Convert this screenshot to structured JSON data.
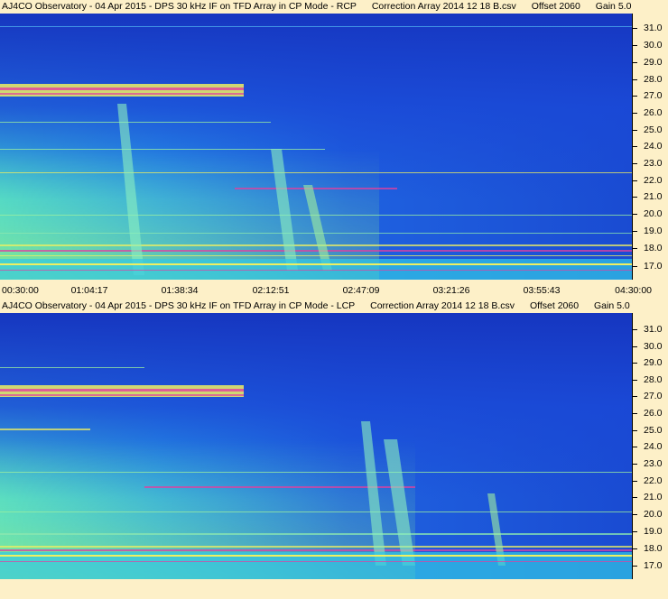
{
  "panels": [
    {
      "title_left": "AJ4CO Observatory - 04 Apr 2015 - DPS 30 kHz IF on TFD Array in CP Mode - RCP",
      "title_correction": "Correction Array 2014 12 18 B.csv",
      "title_offset": "Offset 2060",
      "title_gain": "Gain 5.0",
      "polarization": "RCP"
    },
    {
      "title_left": "AJ4CO Observatory - 04 Apr 2015 - DPS 30 kHz IF on TFD Array in CP Mode - LCP",
      "title_correction": "Correction Array 2014 12 18 B.csv",
      "title_offset": "Offset 2060",
      "title_gain": "Gain 5.0",
      "polarization": "LCP"
    }
  ],
  "y_axis_ticks": [
    "31.0",
    "30.0",
    "29.0",
    "28.0",
    "27.0",
    "26.0",
    "25.0",
    "24.0",
    "23.0",
    "22.0",
    "21.0",
    "20.0",
    "19.0",
    "18.0",
    "17.0"
  ],
  "x_axis_ticks": [
    "00:30:00",
    "01:04:17",
    "01:38:34",
    "02:12:51",
    "02:47:09",
    "03:21:26",
    "03:55:43",
    "04:30:00"
  ],
  "colors": {
    "background": "#fdf0c8",
    "deep_blue": "#1433c8",
    "mid_blue": "#1e5ae6",
    "cyan": "#32c8e6",
    "green": "#8cf08c",
    "yellow": "#f0f050",
    "magenta": "#e632aa"
  }
}
